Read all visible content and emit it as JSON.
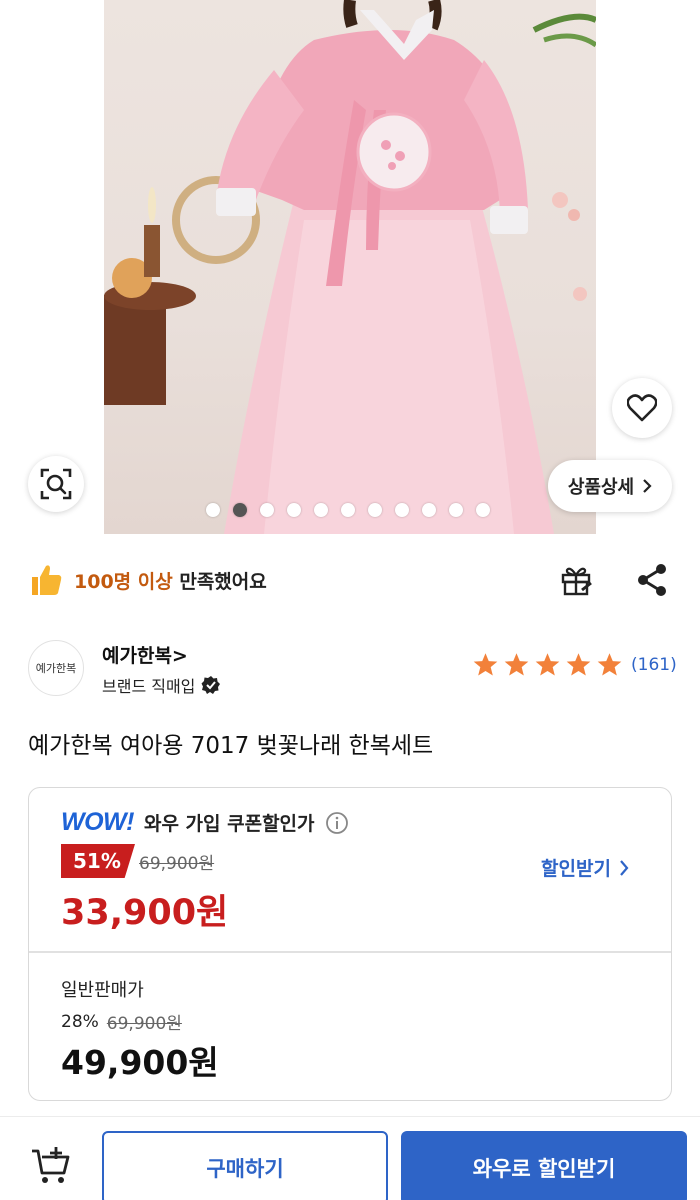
{
  "gallery": {
    "detail_button_label": "상품상세",
    "dot_count": 11,
    "active_dot_index": 1
  },
  "satisfaction": {
    "highlight": "100명 이상",
    "rest": "만족했어요",
    "icon": "thumbs-up-icon"
  },
  "brand": {
    "logo_text": "예가한복",
    "name": "예가한복>",
    "subtitle": "브랜드 직매입"
  },
  "rating": {
    "stars": 5,
    "count": "(161)"
  },
  "product": {
    "title": "예가한복 여아용 7017 벚꽃나래 한복세트"
  },
  "wow_price": {
    "logo": "WOW!",
    "label": "와우 가입 쿠폰할인가",
    "discount": "51%",
    "original_price": "69,900원",
    "sale_price": "33,900원",
    "coupon_link": "할인받기"
  },
  "normal_price": {
    "label": "일반판매가",
    "discount": "28%",
    "original_price": "69,900원",
    "price": "49,900원"
  },
  "bottom_bar": {
    "buy_label": "구매하기",
    "wow_buy_label": "와우로 할인받기"
  },
  "colors": {
    "accent_blue": "#2e64c7",
    "sale_red": "#c81e1e",
    "star_orange": "#f2813a",
    "satisfaction_orange": "#c35a0f"
  }
}
